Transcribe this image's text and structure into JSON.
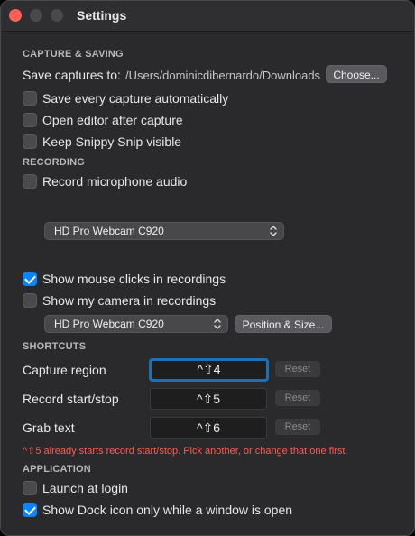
{
  "window": {
    "title": "Settings"
  },
  "capture": {
    "section": "CAPTURE & SAVING",
    "save_label": "Save captures to:",
    "save_path": "/Users/dominicdibernardo/Downloads",
    "choose_button": "Choose...",
    "options": [
      {
        "label": "Save every capture automatically",
        "checked": false
      },
      {
        "label": "Open editor after capture",
        "checked": false
      },
      {
        "label": "Keep Snippy Snip visible",
        "checked": false
      }
    ]
  },
  "recording": {
    "section": "RECORDING",
    "mic_label": "Record microphone audio",
    "mic_checked": false,
    "mic_device": "HD Pro Webcam C920",
    "clicks_label": "Show mouse clicks in recordings",
    "clicks_checked": true,
    "camera_label": "Show my camera in recordings",
    "camera_checked": false,
    "camera_device": "HD Pro Webcam C920",
    "position_button": "Position & Size..."
  },
  "shortcuts": {
    "section": "SHORTCUTS",
    "reset_label": "Reset",
    "rows": [
      {
        "label": "Capture region",
        "keys": "^⇧4"
      },
      {
        "label": "Record start/stop",
        "keys": "^⇧5"
      },
      {
        "label": "Grab text",
        "keys": "^⇧6"
      }
    ],
    "warning": "^⇧5 already starts record start/stop. Pick another, or change that one first."
  },
  "application": {
    "section": "APPLICATION",
    "login_label": "Launch at login",
    "login_checked": false,
    "dock_label": "Show Dock icon only while a window is open",
    "dock_checked": true
  }
}
